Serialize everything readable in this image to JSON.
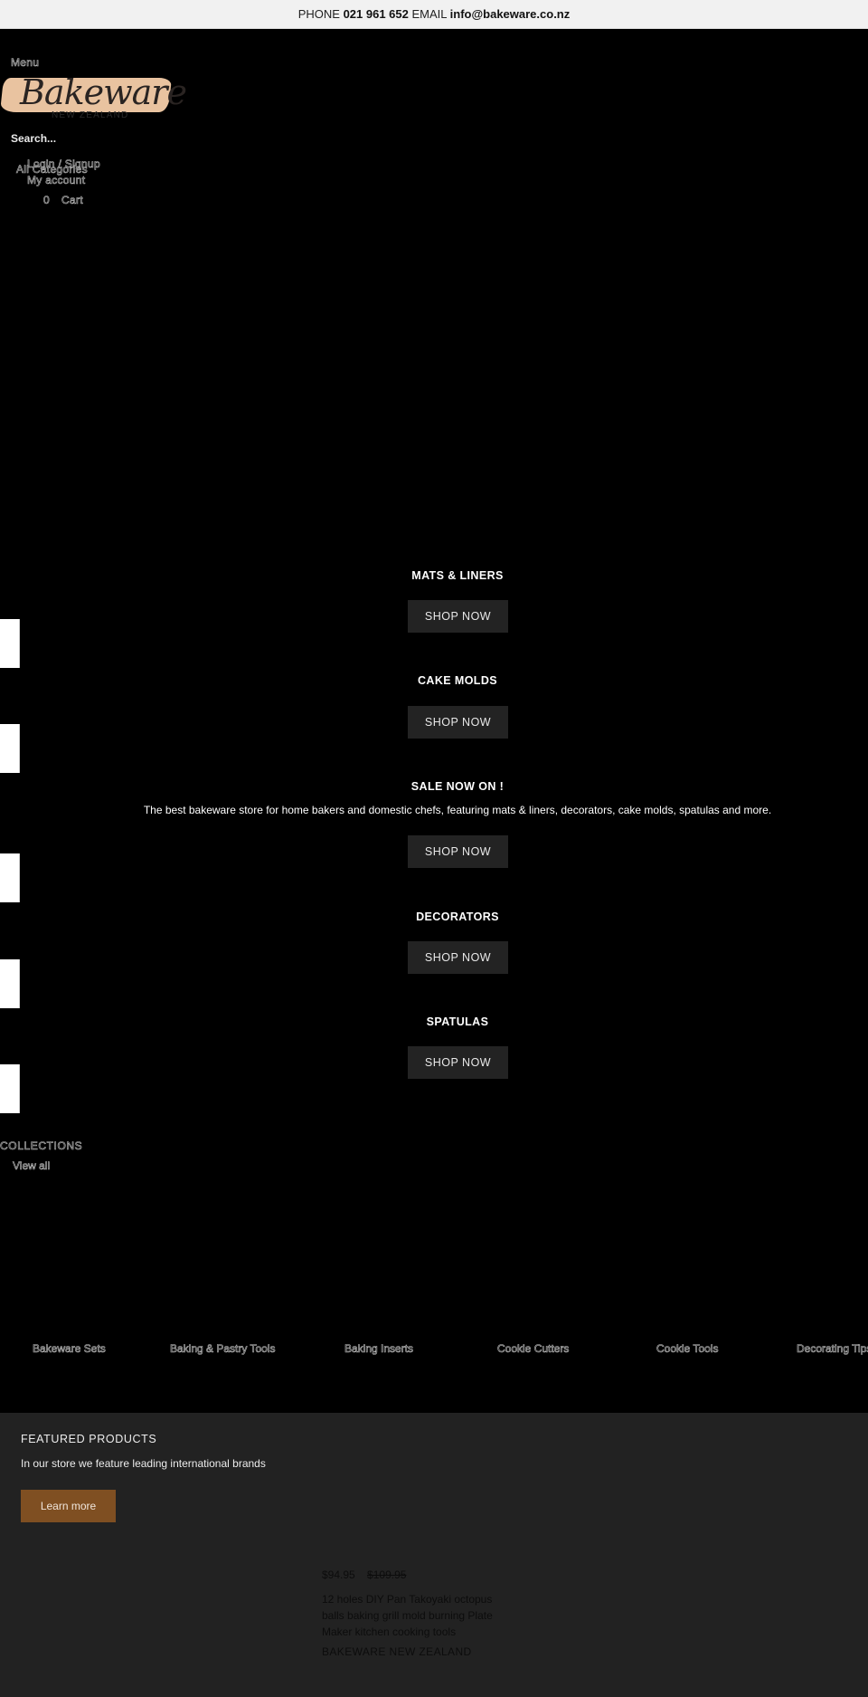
{
  "announcement": {
    "phone_label": "PHONE",
    "phone": "021 961 652",
    "email_label": "EMAIL",
    "email": "info@bakeware.co.nz"
  },
  "header": {
    "menu_label": "Menu",
    "logo_text": "Bakeware",
    "logo_subtitle": "NEW ZEALAND",
    "search_label": "Search...",
    "all_categories_label": "All Categories",
    "login_label": "Login / Signup",
    "account_label": "My account",
    "cart_count": "0",
    "cart_label": "Cart"
  },
  "hero_slides": [
    {
      "title": "MATS & LINERS",
      "button": "SHOP NOW"
    },
    {
      "title": "CAKE MOLDS",
      "button": "SHOP NOW"
    },
    {
      "title": "SALE NOW ON !",
      "description": "The best bakeware store for home bakers and domestic chefs, featuring mats & liners, decorators, cake molds, spatulas and more.",
      "button": "SHOP NOW"
    },
    {
      "title": "DECORATORS",
      "button": "SHOP NOW"
    },
    {
      "title": "SPATULAS",
      "button": "SHOP NOW"
    }
  ],
  "collections": {
    "title": "COLLECTIONS",
    "view_all": "View all",
    "items": [
      "Bakeware Sets",
      "Baking & Pastry Tools",
      "Baking Inserts",
      "Cookie Cutters",
      "Cookie Tools",
      "Decorating Tips"
    ]
  },
  "featured": {
    "title": "FEATURED PRODUCTS",
    "subtitle": "In our store we feature leading international brands",
    "button": "Learn more",
    "product": {
      "price": "$94.95",
      "compare_price": "$109.95",
      "name": "12 holes DIY Pan Takoyaki octopus balls baking grill mold burning Plate Maker kitchen cooking tools",
      "vendor": "BAKEWARE NEW ZEALAND"
    }
  },
  "colors": {
    "accent_button": "#7f4f22",
    "logo_brush": "#e9c3a0",
    "shop_button": "#232323",
    "featured_bg": "#222222"
  }
}
